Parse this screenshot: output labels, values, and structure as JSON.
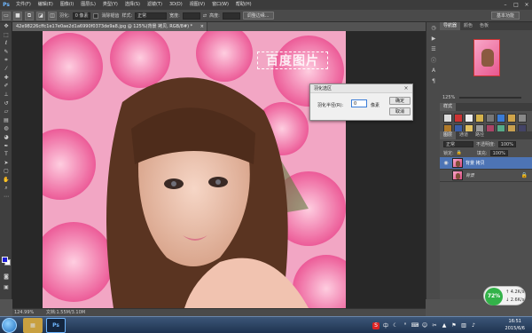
{
  "app": {
    "logo": "Ps"
  },
  "menu": [
    "文件(F)",
    "编辑(E)",
    "图像(I)",
    "图层(L)",
    "类型(Y)",
    "选择(S)",
    "滤镜(T)",
    "3D(D)",
    "视图(V)",
    "窗口(W)",
    "帮助(H)"
  ],
  "window_controls": [
    "–",
    "□",
    "×"
  ],
  "options_bar": {
    "feather_label": "羽化:",
    "feather_value": "0 像素",
    "antialias_label": "消除锯齿",
    "style_label": "样式:",
    "style_value": "正常",
    "width_label": "宽度:",
    "height_label": "高度:",
    "refine_edge_button": "调整边缘...",
    "workspace_button": "基本功能"
  },
  "document": {
    "tab_title": "42e98226cffc1e17e0ae2d1a6990f0373de9a8.jpg @ 125%(背景 拷贝, RGB/8#) *",
    "watermark": "百度图片"
  },
  "dialog": {
    "title": "羽化选区",
    "radius_label": "羽化半径(R):",
    "radius_value": "0",
    "unit": "像素",
    "ok_button": "确定",
    "cancel_button": "取消"
  },
  "panels": {
    "navigator_tabs": [
      "导航器",
      "颜色",
      "色板"
    ],
    "nav_zoom": "125%",
    "styles_tab": "样式",
    "layers_tabs": [
      "图层",
      "通道",
      "路径"
    ],
    "blend_mode": "正常",
    "opacity_label": "不透明度:",
    "opacity_value": "100%",
    "lock_label": "锁定:",
    "fill_label": "填充:",
    "fill_value": "100%",
    "layers": [
      {
        "name": "背景 拷贝",
        "selected": true
      },
      {
        "name": "背景",
        "selected": false
      }
    ]
  },
  "status": {
    "zoom": "124.99%",
    "doc_info": "文档:1.55M/3.10M"
  },
  "network": {
    "percent": "72%",
    "up": "4.2K/s",
    "down": "2.6K/s"
  },
  "taskbar": {
    "time": "16:51",
    "date": "2015/6/6",
    "ps_label": "Ps"
  },
  "colors": {
    "foreground": "#1c1cd4",
    "background": "#ffffff",
    "selected_layer": "#4d74b5"
  }
}
